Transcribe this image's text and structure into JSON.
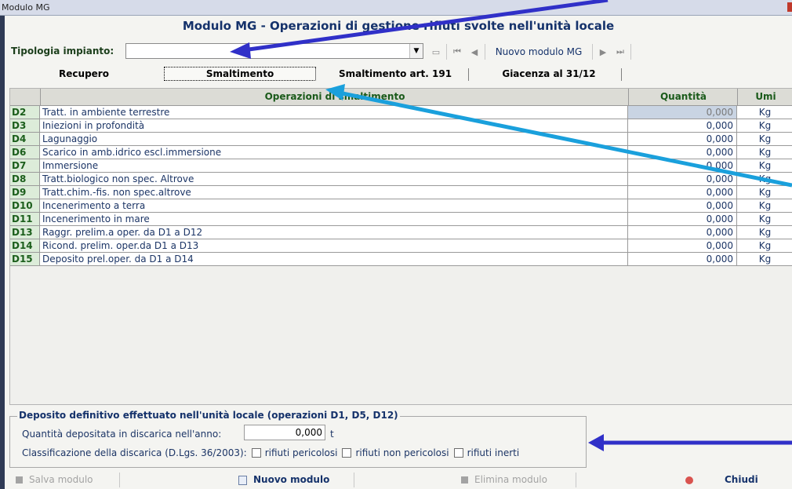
{
  "window": {
    "title": "Modulo MG"
  },
  "heading": "Modulo MG - Operazioni di gestione rifiuti svolte nell'unità locale",
  "tipologia": {
    "label": "Tipologia impianto:",
    "value": ""
  },
  "nav": {
    "nuovo_label": "Nuovo modulo MG"
  },
  "tabs": [
    {
      "label": "Recupero",
      "selected": false
    },
    {
      "label": "Smaltimento",
      "selected": true
    },
    {
      "label": "Smaltimento art. 191",
      "selected": false
    },
    {
      "label": "Giacenza al 31/12",
      "selected": false
    }
  ],
  "grid": {
    "headers": {
      "operazioni": "Operazioni di smaltimento",
      "quantita": "Quantità",
      "umi": "Umi"
    },
    "rows": [
      {
        "code": "D2",
        "desc": "Tratt. in ambiente terrestre",
        "qty": "0,000",
        "umi": "Kg"
      },
      {
        "code": "D3",
        "desc": "Iniezioni in profondità",
        "qty": "0,000",
        "umi": "Kg"
      },
      {
        "code": "D4",
        "desc": "Lagunaggio",
        "qty": "0,000",
        "umi": "Kg"
      },
      {
        "code": "D6",
        "desc": "Scarico in amb.idrico escl.immersione",
        "qty": "0,000",
        "umi": "Kg"
      },
      {
        "code": "D7",
        "desc": "Immersione",
        "qty": "0,000",
        "umi": "Kg"
      },
      {
        "code": "D8",
        "desc": "Tratt.biologico non spec. Altrove",
        "qty": "0,000",
        "umi": "Kg"
      },
      {
        "code": "D9",
        "desc": "Tratt.chim.-fis. non spec.altrove",
        "qty": "0,000",
        "umi": "Kg"
      },
      {
        "code": "D10",
        "desc": "Incenerimento a terra",
        "qty": "0,000",
        "umi": "Kg"
      },
      {
        "code": "D11",
        "desc": "Incenerimento in mare",
        "qty": "0,000",
        "umi": "Kg"
      },
      {
        "code": "D13",
        "desc": "Raggr. prelim.a oper. da D1 a D12",
        "qty": "0,000",
        "umi": "Kg"
      },
      {
        "code": "D14",
        "desc": "Ricond. prelim. oper.da D1 a D13",
        "qty": "0,000",
        "umi": "Kg"
      },
      {
        "code": "D15",
        "desc": "Deposito prel.oper. da D1 a D14",
        "qty": "0,000",
        "umi": "Kg"
      }
    ]
  },
  "deposito": {
    "legend": "Deposito definitivo effettuato nell'unità locale (operazioni D1, D5, D12)",
    "quantita_label": "Quantità depositata in discarica nell'anno:",
    "quantita_value": "0,000",
    "quantita_unit": "t",
    "classificazione_label": "Classificazione della discarica (D.Lgs. 36/2003):",
    "options": [
      "rifiuti pericolosi",
      "rifiuti non pericolosi",
      "rifiuti inerti"
    ]
  },
  "footer": {
    "salva": "Salva modulo",
    "nuovo": "Nuovo modulo",
    "elimina": "Elimina modulo",
    "chiudi": "Chiudi"
  },
  "colors": {
    "arrow_dark": "#3030c8",
    "arrow_light": "#1aa0dc"
  },
  "icons": [
    "dropdown-arrow-icon",
    "calendar-icon",
    "first-record-icon",
    "prev-record-icon",
    "next-record-icon",
    "last-record-icon",
    "save-icon",
    "new-doc-icon",
    "delete-icon",
    "close-icon"
  ]
}
